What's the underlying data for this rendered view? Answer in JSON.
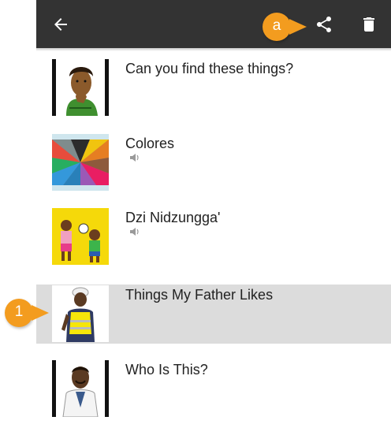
{
  "app_bar": {
    "icons": {
      "back": "arrow-left-icon",
      "share": "share-icon",
      "delete": "trash-icon"
    },
    "color": "#333333"
  },
  "books": [
    {
      "title": "Can you find these things?",
      "has_audio": false,
      "selected": false,
      "thumbnail": "woman-thinking-portrait"
    },
    {
      "title": "Colores",
      "has_audio": true,
      "selected": false,
      "thumbnail": "color-wheel"
    },
    {
      "title": "Dzi Nidzungga'",
      "has_audio": true,
      "selected": false,
      "thumbnail": "children-playing-ball"
    },
    {
      "title": "Things My Father Likes",
      "has_audio": false,
      "selected": true,
      "thumbnail": "worker-in-safety-vest"
    },
    {
      "title": "Who Is This?",
      "has_audio": false,
      "selected": false,
      "thumbnail": "man-in-lab-coat"
    }
  ],
  "callouts": {
    "share": "a",
    "selected_book": "1"
  },
  "colors": {
    "callout": "#f39c1f",
    "selected_row": "#dcdcdc"
  }
}
